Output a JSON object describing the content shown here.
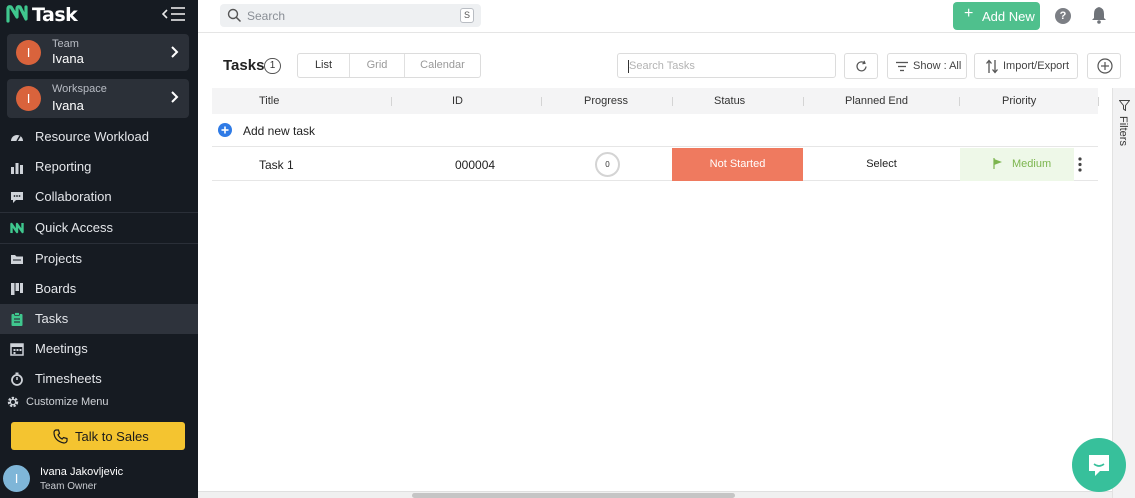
{
  "app": {
    "name": "Task"
  },
  "sidebar": {
    "team": {
      "sub": "Team",
      "name": "Ivana",
      "initial": "I"
    },
    "workspace": {
      "sub": "Workspace",
      "name": "Ivana",
      "initial": "I"
    },
    "items": [
      {
        "label": "Resource Workload",
        "icon": "gauge-icon"
      },
      {
        "label": "Reporting",
        "icon": "bar-chart-icon"
      },
      {
        "label": "Collaboration",
        "icon": "chat-bubble-icon"
      },
      {
        "label": "Quick Access",
        "icon": "logo-icon"
      },
      {
        "label": "Projects",
        "icon": "folder-icon"
      },
      {
        "label": "Boards",
        "icon": "board-icon"
      },
      {
        "label": "Tasks",
        "icon": "clipboard-icon"
      },
      {
        "label": "Meetings",
        "icon": "calendar-icon"
      },
      {
        "label": "Timesheets",
        "icon": "stopwatch-icon"
      }
    ],
    "customize_label": "Customize Menu",
    "talk_to_sales": "Talk to Sales",
    "user": {
      "name": "Ivana Jakovljevic",
      "role": "Team Owner",
      "initial": "I"
    }
  },
  "topbar": {
    "search_placeholder": "Search",
    "search_key": "S",
    "add_new": "Add New",
    "help": "?"
  },
  "toolbar": {
    "title": "Tasks",
    "count": "1",
    "views": [
      "List",
      "Grid",
      "Calendar"
    ],
    "search_placeholder": "Search Tasks",
    "show": "Show : All",
    "import_export": "Import/Export"
  },
  "table": {
    "columns": [
      "Title",
      "ID",
      "Progress",
      "Status",
      "Planned End",
      "Priority"
    ],
    "add_task": "Add new task",
    "rows": [
      {
        "title": "Task 1",
        "id": "000004",
        "progress": "0",
        "status": "Not Started",
        "planned_end": "Select",
        "priority": "Medium"
      }
    ]
  },
  "filters": {
    "label": "Filters"
  },
  "colors": {
    "sidebar_bg": "#161b22",
    "accent_green": "#4fc08d",
    "status_not_started": "#ef7a5f",
    "priority_medium": "#7cb54e",
    "sales_yellow": "#f4c430"
  }
}
